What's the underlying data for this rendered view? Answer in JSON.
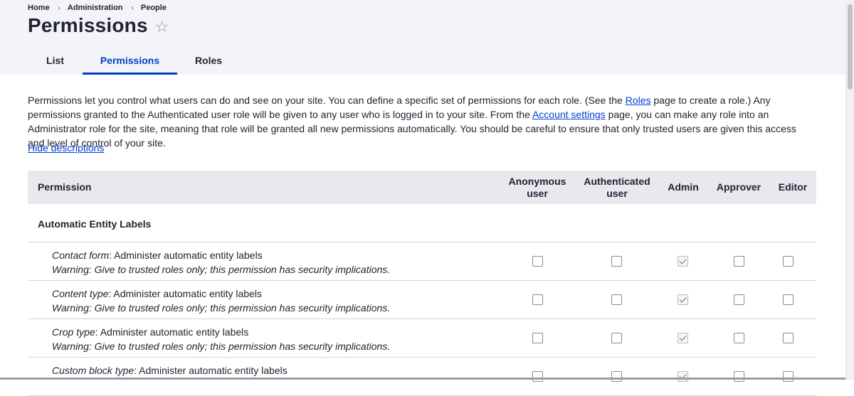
{
  "breadcrumb": {
    "home": "Home",
    "administration": "Administration",
    "people": "People",
    "separator": "›"
  },
  "page": {
    "title": "Permissions",
    "star_icon": "☆"
  },
  "tabs": {
    "list": "List",
    "permissions": "Permissions",
    "roles": "Roles",
    "active": "Permissions"
  },
  "description": {
    "part1": "Permissions let you control what users can do and see on your site. You can define a specific set of permissions for each role. (See the ",
    "roles_link": "Roles",
    "part2": " page to create a role.) Any permissions granted to the Authenticated user role will be given to any user who is logged in to your site. From the ",
    "account_link": "Account settings",
    "part3": " page, you can make any role into an Administrator role for the site, meaning that role will be granted all new permissions automatically. You should be careful to ensure that only trusted users are given this access and level of control of your site."
  },
  "hide_descriptions": "Hide descriptions",
  "table": {
    "headers": {
      "permission": "Permission",
      "anonymous": "Anonymous user",
      "authenticated": "Authenticated user",
      "admin": "Admin",
      "approver": "Approver",
      "editor": "Editor"
    },
    "module": "Automatic Entity Labels",
    "rows": [
      {
        "entity": "Contact form",
        "label": ": Administer automatic entity labels",
        "warning": "Warning: Give to trusted roles only; this permission has security implications.",
        "checked": [
          false,
          false,
          true,
          false,
          false
        ]
      },
      {
        "entity": "Content type",
        "label": ": Administer automatic entity labels",
        "warning": "Warning: Give to trusted roles only; this permission has security implications.",
        "checked": [
          false,
          false,
          true,
          false,
          false
        ]
      },
      {
        "entity": "Crop type",
        "label": ": Administer automatic entity labels",
        "warning": "Warning: Give to trusted roles only; this permission has security implications.",
        "checked": [
          false,
          false,
          true,
          false,
          false
        ]
      },
      {
        "entity": "Custom block type",
        "label": ": Administer automatic entity labels",
        "warning": "",
        "checked": [
          false,
          false,
          true,
          false,
          false
        ]
      }
    ]
  },
  "colors": {
    "link": "#003ecc",
    "header_bg": "#f3f4f9",
    "table_header_bg": "#e8e9ef",
    "text": "#222330"
  }
}
